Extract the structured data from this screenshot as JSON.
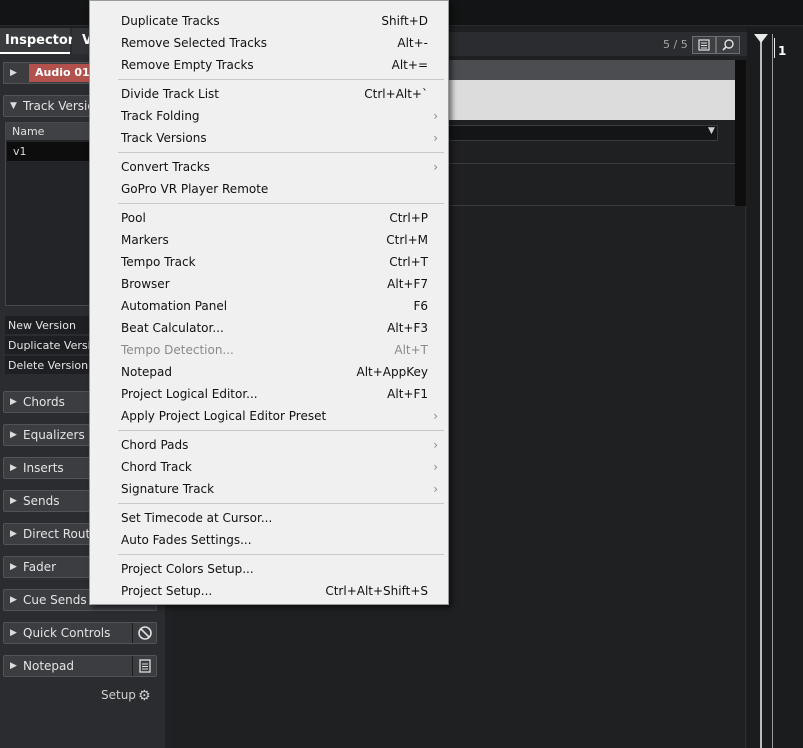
{
  "inspector": {
    "tab_inspector": "Inspector",
    "tab_other": "V",
    "track_name": "Audio 01",
    "track_versions_section": "Track Versions",
    "versions_column": "Name",
    "version_row": "v1",
    "version_buttons": [
      "New Version",
      "Duplicate Version",
      "Delete Version"
    ],
    "sections": [
      "Chords",
      "Equalizers",
      "Inserts",
      "Sends",
      "Direct Routing",
      "Fader",
      "Cue Sends",
      "Quick Controls",
      "Notepad"
    ],
    "setup_label": "Setup"
  },
  "project": {
    "track_count": "5 / 5",
    "bar_number": "1"
  },
  "menu": {
    "groups": [
      [
        {
          "label": "Duplicate Tracks",
          "shortcut": "Shift+D"
        },
        {
          "label": "Remove Selected Tracks",
          "shortcut": "Alt+-"
        },
        {
          "label": "Remove Empty Tracks",
          "shortcut": "Alt+="
        }
      ],
      [
        {
          "label": "Divide Track List",
          "shortcut": "Ctrl+Alt+`"
        },
        {
          "label": "Track Folding",
          "submenu": true
        },
        {
          "label": "Track Versions",
          "submenu": true
        }
      ],
      [
        {
          "label": "Convert Tracks",
          "submenu": true
        },
        {
          "label": "GoPro VR Player Remote"
        }
      ],
      [
        {
          "label": "Pool",
          "shortcut": "Ctrl+P"
        },
        {
          "label": "Markers",
          "shortcut": "Ctrl+M"
        },
        {
          "label": "Tempo Track",
          "shortcut": "Ctrl+T"
        },
        {
          "label": "Browser",
          "shortcut": "Alt+F7"
        },
        {
          "label": "Automation Panel",
          "shortcut": "F6"
        },
        {
          "label": "Beat Calculator...",
          "shortcut": "Alt+F3"
        },
        {
          "label": "Tempo Detection...",
          "shortcut": "Alt+T",
          "disabled": true
        },
        {
          "label": "Notepad",
          "shortcut": "Alt+AppKey"
        },
        {
          "label": "Project Logical Editor...",
          "shortcut": "Alt+F1"
        },
        {
          "label": "Apply Project Logical Editor Preset",
          "submenu": true
        }
      ],
      [
        {
          "label": "Chord Pads",
          "submenu": true
        },
        {
          "label": "Chord Track",
          "submenu": true
        },
        {
          "label": "Signature Track",
          "submenu": true
        }
      ],
      [
        {
          "label": "Set Timecode at Cursor..."
        },
        {
          "label": "Auto Fades Settings..."
        }
      ],
      [
        {
          "label": "Project Colors Setup..."
        },
        {
          "label": "Project Setup...",
          "shortcut": "Ctrl+Alt+Shift+S"
        }
      ]
    ]
  },
  "icons": {
    "expand": "triangle-right-icon",
    "collapse": "triangle-down-icon",
    "submenu": "chevron-right-icon",
    "gear": "gear-icon",
    "search": "search-icon",
    "list": "list-icon"
  },
  "colors": {
    "track_color": "#b3524c",
    "menu_bg": "#f0f0f0",
    "inspector_bg": "#2b2c2f"
  }
}
